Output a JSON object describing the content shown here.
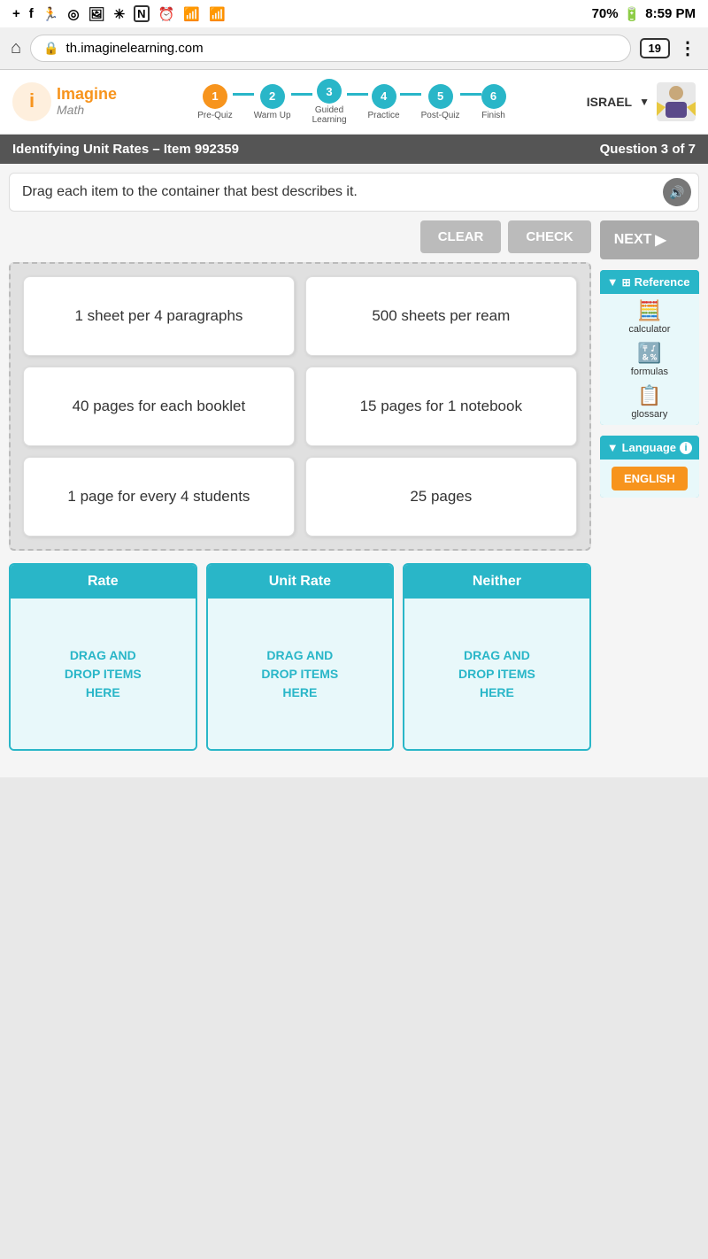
{
  "statusBar": {
    "leftIcons": [
      "+",
      "f",
      "🏃",
      "◎",
      "🖼",
      "❄",
      "N",
      "⏰",
      "📶",
      "📶"
    ],
    "battery": "70%",
    "time": "8:59 PM"
  },
  "browserBar": {
    "homeIcon": "⌂",
    "url": "th.imaginelearning.com",
    "tabCount": "19",
    "menuIcon": "⋮"
  },
  "logo": {
    "imagine": "Imagine",
    "math": "Math"
  },
  "progressSteps": [
    {
      "number": "1",
      "label": "Pre-Quiz",
      "state": "active"
    },
    {
      "number": "2",
      "label": "Warm Up",
      "state": "future"
    },
    {
      "number": "3",
      "label": "Guided\nLearning",
      "state": "future"
    },
    {
      "number": "4",
      "label": "Practice",
      "state": "future"
    },
    {
      "number": "5",
      "label": "Post-Quiz",
      "state": "future"
    },
    {
      "number": "6",
      "label": "Finish",
      "state": "future"
    }
  ],
  "user": {
    "name": "ISRAEL"
  },
  "questionHeader": {
    "title": "Identifying Unit Rates – Item 992359",
    "questionInfo": "Question 3 of 7"
  },
  "instruction": {
    "text": "Drag each item to the container that best describes it."
  },
  "buttons": {
    "next": "NEXT",
    "clear": "CLEAR",
    "check": "CHECK"
  },
  "reference": {
    "title": "Reference",
    "items": [
      {
        "label": "calculator",
        "icon": "🖩"
      },
      {
        "label": "formulas",
        "icon": "🔣"
      },
      {
        "label": "glossary",
        "icon": "📋"
      }
    ]
  },
  "language": {
    "title": "Language",
    "infoIcon": "ℹ",
    "currentLanguage": "ENGLISH"
  },
  "dragItems": [
    {
      "id": "item1",
      "text": "1 sheet per 4 paragraphs"
    },
    {
      "id": "item2",
      "text": "500 sheets per ream"
    },
    {
      "id": "item3",
      "text": "40 pages for each booklet"
    },
    {
      "id": "item4",
      "text": "15 pages for 1 notebook"
    },
    {
      "id": "item5",
      "text": "1 page for every 4 students"
    },
    {
      "id": "item6",
      "text": "25 pages"
    }
  ],
  "dropZones": [
    {
      "id": "rate",
      "label": "Rate",
      "placeholder": "DRAG AND\nDROP ITEMS\nHERE"
    },
    {
      "id": "unit-rate",
      "label": "Unit Rate",
      "placeholder": "DRAG AND\nDROP ITEMS\nHERE"
    },
    {
      "id": "neither",
      "label": "Neither",
      "placeholder": "DRAG AND\nDROP ITEMS\nHERE"
    }
  ]
}
